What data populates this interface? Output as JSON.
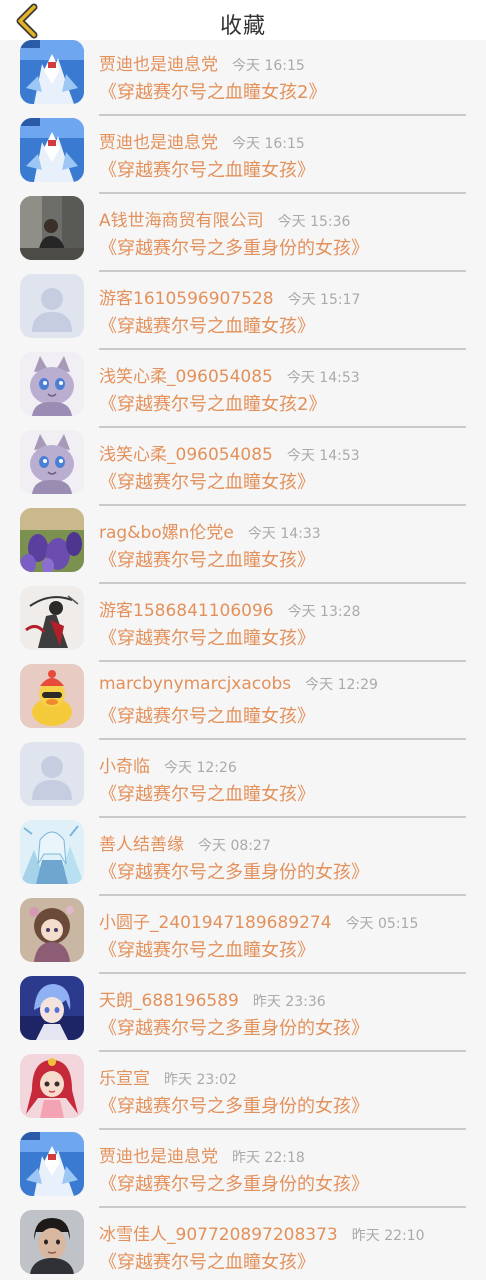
{
  "header": {
    "title": "收藏",
    "back_icon": "chevron-left-icon",
    "accent_color": "#e6b325"
  },
  "colors": {
    "accent": "#e3915b",
    "time": "#aaaaaa",
    "divider": "#c9c9c9"
  },
  "items": [
    {
      "name": "贾迪也是迪息党",
      "time": "今天 16:15",
      "book": "《穿越赛尔号之血瞳女孩2》",
      "avatar": "robot"
    },
    {
      "name": "贾迪也是迪息党",
      "time": "今天 16:15",
      "book": "《穿越赛尔号之血瞳女孩》",
      "avatar": "robot"
    },
    {
      "name": "A钱世海商贸有限公司",
      "time": "今天 15:36",
      "book": "《穿越赛尔号之多重身份的女孩》",
      "avatar": "photo-man"
    },
    {
      "name": "游客1610596907528",
      "time": "今天 15:17",
      "book": "《穿越赛尔号之血瞳女孩》",
      "avatar": "default"
    },
    {
      "name": "浅笑心柔_096054085",
      "time": "今天 14:53",
      "book": "《穿越赛尔号之血瞳女孩2》",
      "avatar": "cat"
    },
    {
      "name": "浅笑心柔_096054085",
      "time": "今天 14:53",
      "book": "《穿越赛尔号之血瞳女孩》",
      "avatar": "cat"
    },
    {
      "name": "rag&bo嫘n伦党e",
      "time": "今天 14:33",
      "book": "《穿越赛尔号之血瞳女孩》",
      "avatar": "lavender"
    },
    {
      "name": "游客1586841106096",
      "time": "今天 13:28",
      "book": "《穿越赛尔号之血瞳女孩》",
      "avatar": "ink"
    },
    {
      "name": "marcbynymarcjxacobs",
      "time": "今天 12:29",
      "book": "《穿越赛尔号之血瞳女孩》",
      "avatar": "duck"
    },
    {
      "name": "小奇临",
      "time": "今天 12:26",
      "book": "《穿越赛尔号之血瞳女孩》",
      "avatar": "default"
    },
    {
      "name": "善人结善缘",
      "time": "今天 08:27",
      "book": "《穿越赛尔号之多重身份的女孩》",
      "avatar": "anime-ice"
    },
    {
      "name": "小圆子_2401947189689274",
      "time": "今天 05:15",
      "book": "《穿越赛尔号之血瞳女孩》",
      "avatar": "anime-girl"
    },
    {
      "name": "天朗_688196589",
      "time": "昨天 23:36",
      "book": "《穿越赛尔号之多重身份的女孩》",
      "avatar": "anime-boy"
    },
    {
      "name": "乐宣宣",
      "time": "昨天 23:02",
      "book": "《穿越赛尔号之多重身份的女孩》",
      "avatar": "doll"
    },
    {
      "name": "贾迪也是迪息党",
      "time": "昨天 22:18",
      "book": "《穿越赛尔号之多重身份的女孩》",
      "avatar": "robot"
    },
    {
      "name": "冰雪佳人_907720897208373",
      "time": "昨天 22:10",
      "book": "《穿越赛尔号之血瞳女孩》",
      "avatar": "photo-boy"
    }
  ]
}
